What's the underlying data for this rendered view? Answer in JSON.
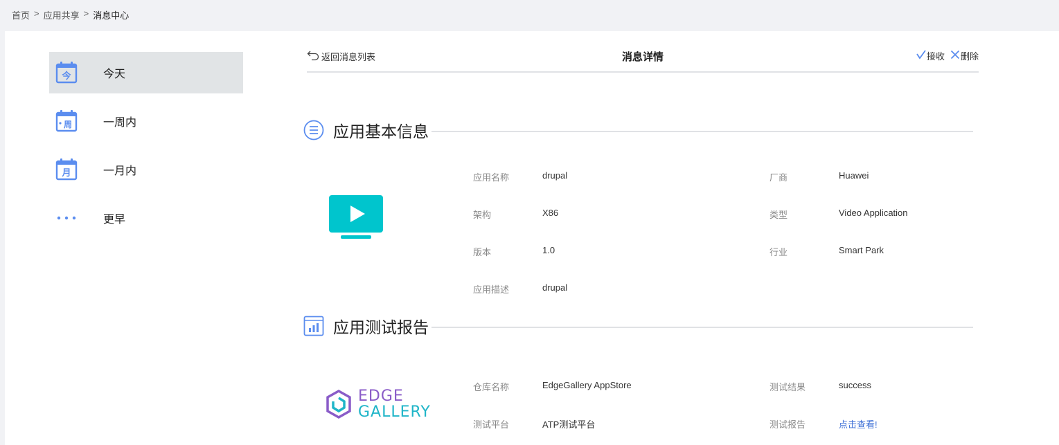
{
  "breadcrumb": {
    "home": "首页",
    "sep1": ">",
    "share": "应用共享",
    "sep2": ">",
    "current": "消息中心"
  },
  "sidebar": {
    "items": [
      {
        "label": "今天",
        "icon": "calendar-today-icon",
        "icon_text": "今",
        "active": true
      },
      {
        "label": "一周内",
        "icon": "calendar-week-icon",
        "icon_text": "周"
      },
      {
        "label": "一月内",
        "icon": "calendar-month-icon",
        "icon_text": "月"
      },
      {
        "label": "更早",
        "icon": "more-dots-icon"
      }
    ]
  },
  "header": {
    "back_label": "返回消息列表",
    "title": "消息详情",
    "accept_label": "接收",
    "delete_label": "删除"
  },
  "basic_info": {
    "title": "应用基本信息",
    "fields": {
      "name_key": "应用名称",
      "name_val": "drupal",
      "vendor_key": "厂商",
      "vendor_val": "Huawei",
      "arch_key": "架构",
      "arch_val": "X86",
      "type_key": "类型",
      "type_val": "Video Application",
      "version_key": "版本",
      "version_val": "1.0",
      "industry_key": "行业",
      "industry_val": "Smart Park",
      "desc_key": "应用描述",
      "desc_val": "drupal"
    }
  },
  "test_report": {
    "title": "应用测试报告",
    "logo_line1": "EDGE",
    "logo_line2": "GALLERY",
    "fields": {
      "repo_key": "仓库名称",
      "repo_val": "EdgeGallery AppStore",
      "result_key": "测试结果",
      "result_val": "success",
      "platform_key": "测试平台",
      "platform_val": "ATP测试平台",
      "report_key": "测试报告",
      "report_val": "点击查看!"
    }
  },
  "colors": {
    "accent": "#5b8def",
    "video_icon": "#00c5cd",
    "link": "#3d6fd6",
    "logo_purple": "#8a5cc8",
    "logo_teal": "#1fb5c8"
  }
}
